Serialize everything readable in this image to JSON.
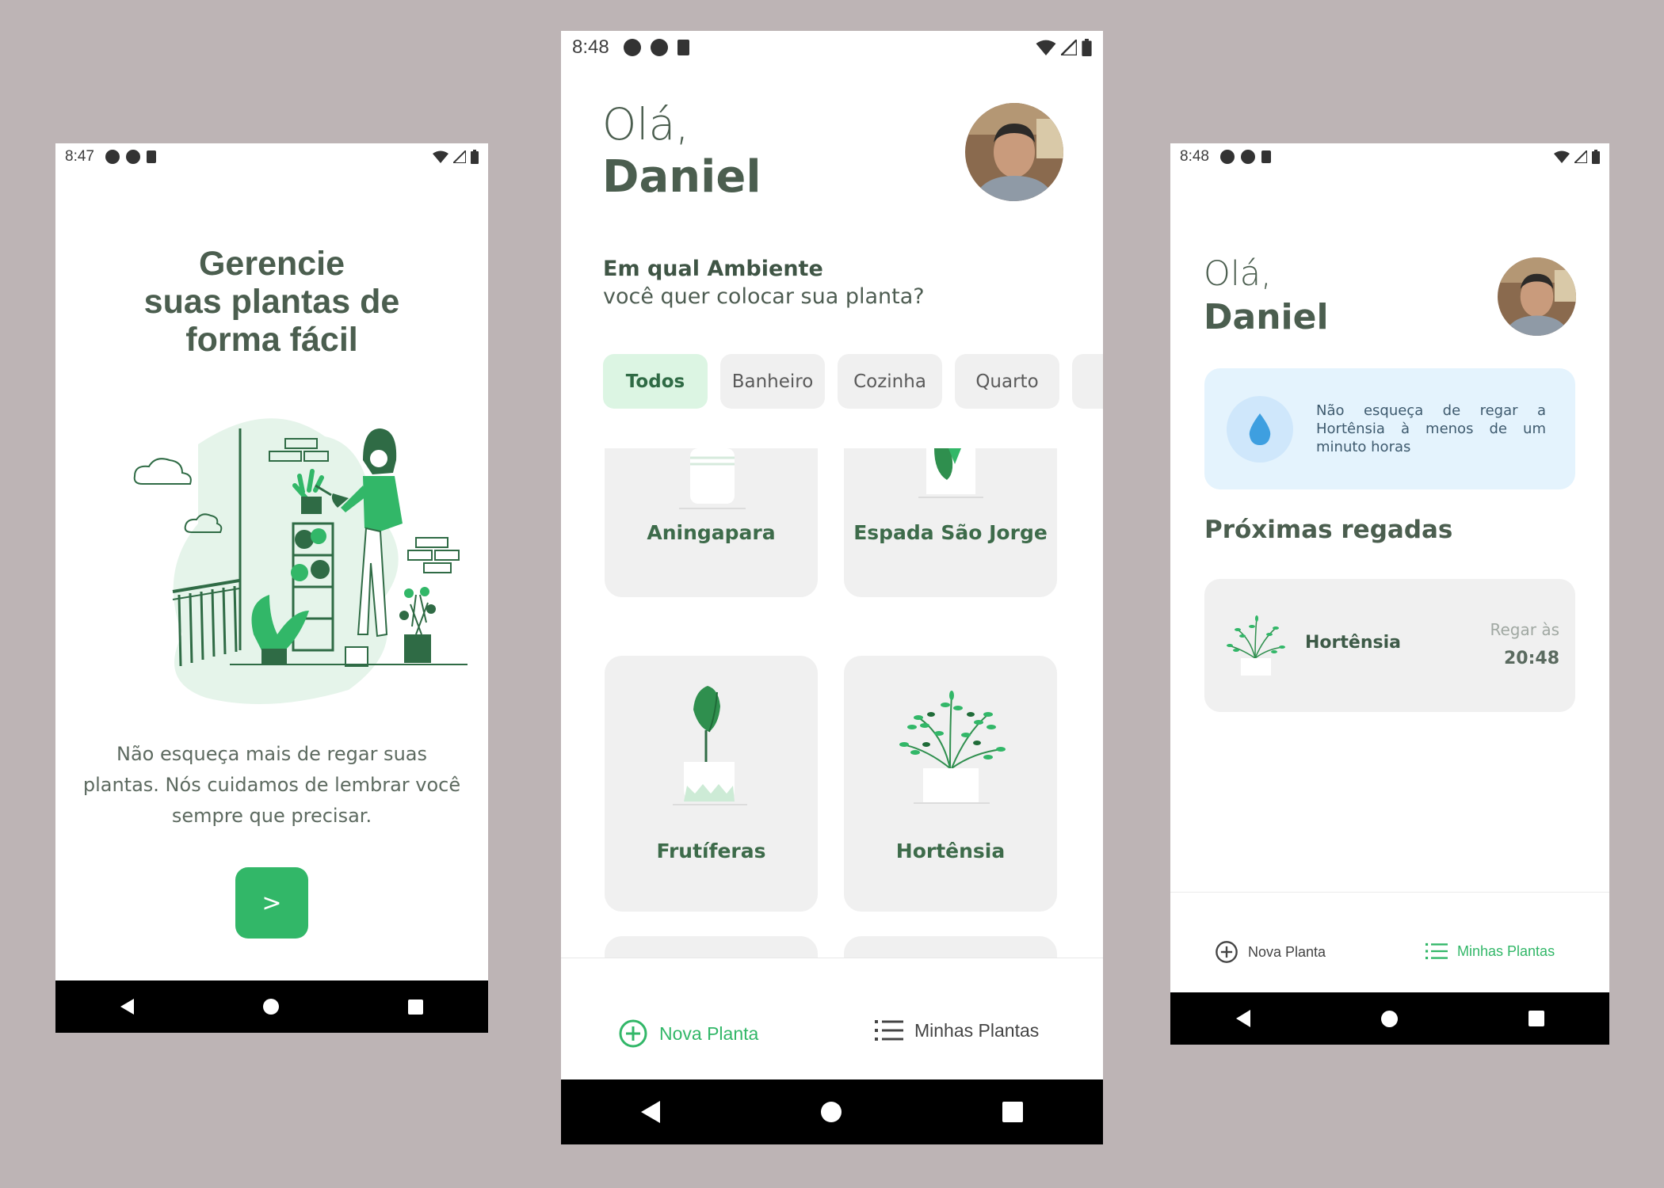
{
  "colors": {
    "background": "#bdb4b5",
    "brand_green": "#32b768",
    "title_text": "#4b5e4f",
    "chip_active_bg": "#dcf5e3",
    "card_bg": "#f0f0f0",
    "tip_bg": "#e4f3fd",
    "water_blue": "#3e9fe0"
  },
  "screen1": {
    "status_time": "8:47",
    "title_line1": "Gerencie",
    "title_line2": "suas plantas de",
    "title_line3": "forma fácil",
    "description": "Não esqueça mais de regar suas plantas. Nós cuidamos de lembrar você sempre que precisar.",
    "start_button": ">"
  },
  "screen2": {
    "status_time": "8:48",
    "greeting": "Olá,",
    "user_name": "Daniel",
    "question_strong": "Em qual Ambiente",
    "question_light": "você quer colocar sua planta?",
    "environments": [
      {
        "label": "Todos",
        "active": true
      },
      {
        "label": "Banheiro",
        "active": false
      },
      {
        "label": "Cozinha",
        "active": false
      },
      {
        "label": "Quarto",
        "active": false
      },
      {
        "label": "",
        "active": false
      }
    ],
    "plants": [
      {
        "name": "Aningapara",
        "icon": "aningapara-plant-icon"
      },
      {
        "name": "Espada São Jorge",
        "icon": "espada-sao-jorge-plant-icon"
      },
      {
        "name": "Frutíferas",
        "icon": "frutiferas-plant-icon"
      },
      {
        "name": "Hortênsia",
        "icon": "hortensia-plant-icon"
      },
      {
        "name": "",
        "icon": "grass-plant-icon"
      },
      {
        "name": "",
        "icon": "sprouts-plant-icon"
      }
    ],
    "tabs": {
      "new_plant": "Nova Planta",
      "my_plants": "Minhas Plantas",
      "active": "new_plant"
    }
  },
  "screen3": {
    "status_time": "8:48",
    "greeting": "Olá,",
    "user_name": "Daniel",
    "tip_text": "Não esqueça de regar a Hortênsia à menos de um minuto horas",
    "next_title": "Próximas regadas",
    "next_watering": {
      "plant_name": "Hortênsia",
      "label": "Regar às",
      "time": "20:48"
    },
    "tabs": {
      "new_plant": "Nova Planta",
      "my_plants": "Minhas Plantas",
      "active": "my_plants"
    }
  }
}
